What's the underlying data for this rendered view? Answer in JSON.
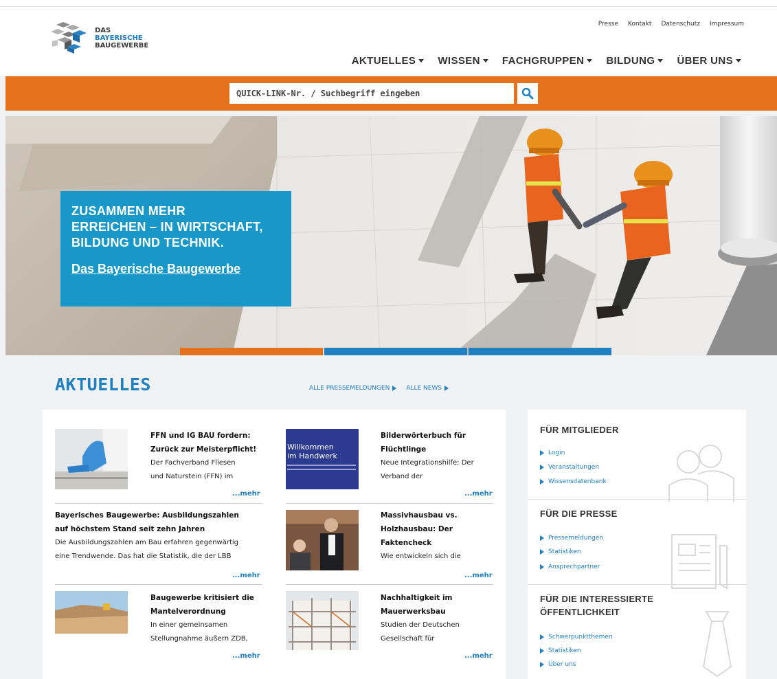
{
  "logo": {
    "line1": "DAS",
    "line2": "BAYERISCHE",
    "line3": "BAUGEWERBE"
  },
  "meta_nav": [
    "Presse",
    "Kontakt",
    "Datenschutz",
    "Impressum"
  ],
  "main_nav": [
    "AKTUELLES",
    "WISSEN",
    "FACHGRUPPEN",
    "BILDUNG",
    "ÜBER UNS"
  ],
  "search": {
    "placeholder": "QUICK-LINK-Nr. / Suchbegriff eingeben",
    "icon": "search-icon"
  },
  "hero": {
    "title_lines": [
      "ZUSAMMEN MEHR",
      "ERREICHEN – IN WIRTSCHAFT,",
      "BILDUNG UND TECHNIK."
    ],
    "link": "Das Bayerische Baugewerbe",
    "slider_colors": [
      "#e6711d",
      "#1f80c2",
      "#1f80c2"
    ]
  },
  "aktuelles": {
    "title": "AKTUELLES",
    "link_press": "ALLE PRESSEMELDUNGEN",
    "link_news": "ALLE NEWS",
    "more": "...mehr",
    "items": [
      {
        "title": [
          "FFN und IG BAU fordern:",
          "Zurück zur Meisterpflicht!"
        ],
        "text": [
          "Der Fachverband Fliesen",
          "und Naturstein (FFN) im"
        ]
      },
      {
        "title": [
          "Bilderwörterbuch für",
          "Flüchtlinge"
        ],
        "text": [
          "Neue Integrationshilfe: Der",
          "Verband der"
        ]
      },
      {
        "title": [
          "Bayerisches Baugewerbe: Ausbildungszahlen",
          "auf höchstem Stand seit zehn Jahren"
        ],
        "text": [
          "Die Ausbildungszahlen am Bau erfahren gegenwärtig",
          "eine Trendwende. Das hat die Statistik, die der LBB"
        ]
      },
      {
        "title": [
          "Massivhausbau vs.",
          "Holzhausbau: Der",
          "Faktencheck"
        ],
        "text": [
          "Wie entwickeln sich die"
        ]
      },
      {
        "title": [
          "Baugewerbe kritisiert die",
          "Mantelverordnung"
        ],
        "text": [
          "In einer gemeinsamen",
          "Stellungnahme äußern ZDB,"
        ]
      },
      {
        "title": [
          "Nachhaltigkeit im",
          "Mauerwerksbau"
        ],
        "text": [
          "Studien der Deutschen",
          "Gesellschaft für"
        ]
      }
    ],
    "thumb_book": {
      "line1": "Willkommen",
      "line2": "im Handwerk"
    }
  },
  "sidebar": {
    "members": {
      "title": "FÜR MITGLIEDER",
      "links": [
        "Login",
        "Veranstaltungen",
        "Wissensdatenbank"
      ],
      "icon": "people-icon"
    },
    "press": {
      "title": "FÜR DIE PRESSE",
      "links": [
        "Pressemeldungen",
        "Statistiken",
        "Ansprechpartner"
      ],
      "icon": "newspaper-icon"
    },
    "public": {
      "title_lines": [
        "FÜR DIE INTERESSIERTE",
        "ÖFFENTLICHKEIT"
      ],
      "links": [
        "Schwerpunktthemen",
        "Statistiken",
        "Über uns"
      ],
      "icon": "tie-icon"
    }
  }
}
